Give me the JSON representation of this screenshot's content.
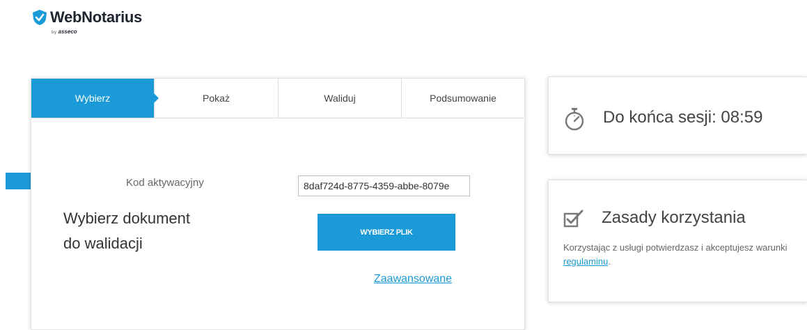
{
  "brand": {
    "name": "WebNotarius",
    "by": "by",
    "company": "asseco"
  },
  "tabs": [
    {
      "label": "Wybierz",
      "active": true
    },
    {
      "label": "Pokaż",
      "active": false
    },
    {
      "label": "Waliduj",
      "active": false
    },
    {
      "label": "Podsumowanie",
      "active": false
    }
  ],
  "form": {
    "code_label": "Kod aktywacyjny",
    "code_value": "8daf724d-8775-4359-abbe-8079e",
    "doc_title_line1": "Wybierz dokument",
    "doc_title_line2": "do walidacji",
    "select_button": "WYBIERZ PLIK",
    "advanced_link": "Zaawansowane"
  },
  "session": {
    "text": "Do końca sesji: 08:59"
  },
  "rules": {
    "title": "Zasady korzystania",
    "text_before": "Korzystając z usługi potwierdzasz i akceptujesz warunki ",
    "link": "regulaminu",
    "text_after": "."
  },
  "icons": {
    "logo": "shield-check-icon",
    "arrow": "arrow-right-icon",
    "timer": "stopwatch-icon",
    "rules": "checkbox-icon"
  },
  "colors": {
    "accent": "#1a9ad6",
    "text": "#333333",
    "muted": "#666666"
  }
}
